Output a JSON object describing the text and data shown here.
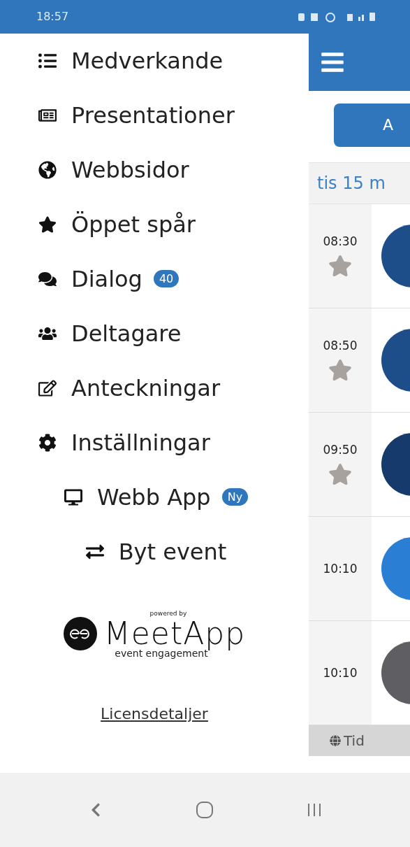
{
  "status_bar": {
    "time": "18:57"
  },
  "drawer": {
    "items": [
      {
        "label": "Medverkande",
        "kind": "menu"
      },
      {
        "label": "Presentationer",
        "kind": "menu"
      },
      {
        "label": "Webbsidor",
        "kind": "menu"
      },
      {
        "label": "Öppet spår",
        "kind": "menu"
      },
      {
        "label": "Dialog",
        "kind": "menu",
        "badge": "40"
      },
      {
        "label": "Deltagare",
        "kind": "menu"
      },
      {
        "label": "Anteckningar",
        "kind": "menu"
      },
      {
        "label": "Inställningar",
        "kind": "menu"
      },
      {
        "label": "Webb App",
        "kind": "centered",
        "badge": "Ny"
      },
      {
        "label": "Byt event",
        "kind": "centered"
      }
    ],
    "logo": {
      "caption": "powered by",
      "name": "MeetApp",
      "tagline": "event engagement"
    },
    "license_link": "Licensdetaljer"
  },
  "app": {
    "button": "A",
    "date": "tis 15 m",
    "sessions": [
      {
        "time": "08:30",
        "favorite": false,
        "color": "#1d4e89"
      },
      {
        "time": "08:50",
        "favorite": false,
        "color": "#1d4e89"
      },
      {
        "time": "09:50",
        "favorite": false,
        "color": "#163a6b"
      },
      {
        "time": "10:10",
        "color": "#2a7fd4"
      },
      {
        "time": "10:10",
        "color": "#5f5f63"
      }
    ],
    "footer_tab": "Tid"
  }
}
